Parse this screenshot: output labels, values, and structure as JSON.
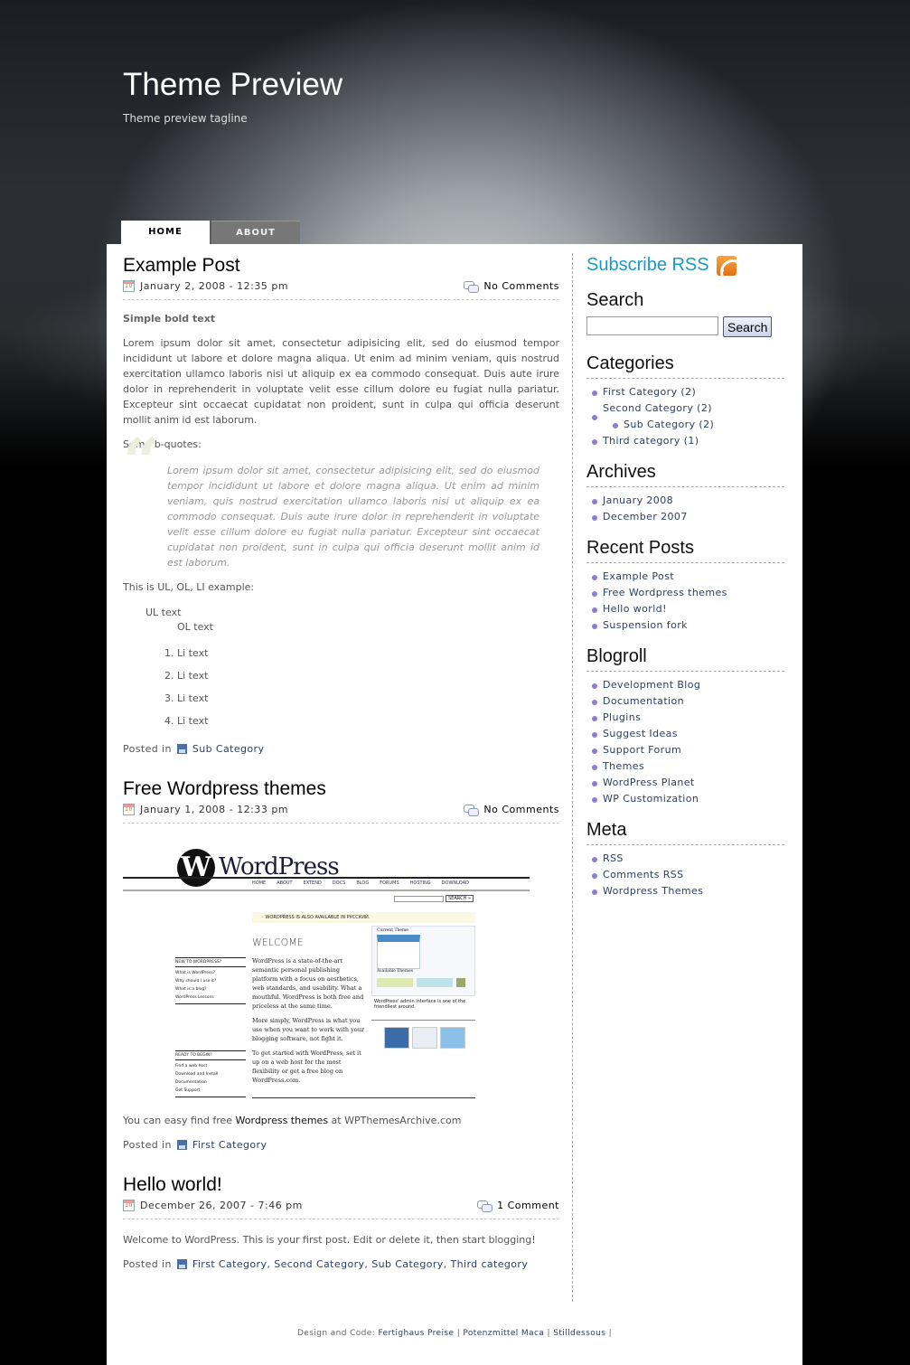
{
  "header": {
    "title": "Theme Preview",
    "tagline": "Theme preview tagline"
  },
  "nav": {
    "tabs": [
      {
        "label": "HOME",
        "active": true
      },
      {
        "label": "ABOUT",
        "active": false
      }
    ]
  },
  "posts": [
    {
      "title": "Example Post",
      "date": "January 2, 2008 - 12:35 pm",
      "comments": "No Comments",
      "bold": "Simple bold text",
      "para": "Lorem ipsum dolor sit amet, consectetur adipisicing elit, sed do eiusmod tempor incididunt ut labore et dolore magna aliqua. Ut enim ad minim veniam, quis nostrud exercitation ullamco laboris nisi ut aliquip ex ea commodo consequat. Duis aute irure dolor in reprehenderit in voluptate velit esse cillum dolore eu fugiat nulla pariatur. Excepteur sint occaecat cupidatat non proident, sunt in culpa qui officia deserunt mollit anim id est laborum.",
      "bquote_intro": "Some b-quotes:",
      "bquote": "Lorem ipsum dolor sit amet, consectetur adipisicing elit, sed do eiusmod tempor incididunt ut labore et dolore magna aliqua. Ut enim ad minim veniam, quis nostrud exercitation ullamco laboris nisi ut aliquip ex ea commodo consequat. Duis aute irure dolor in reprehenderit in voluptate velit esse cillum dolore eu fugiat nulla pariatur. Excepteur sint occaecat cupidatat non proident, sunt in culpa qui officia deserunt mollit anim id est laborum.",
      "list_intro": "This is UL, OL, LI example:",
      "ul_text": "UL text",
      "ol_text": "OL text",
      "li": [
        "Li text",
        "Li text",
        "Li text",
        "Li text"
      ],
      "posted_in": "Posted in",
      "categories": "Sub Category"
    },
    {
      "title": "Free Wordpress themes",
      "date": "January 1, 2008 - 12:33 pm",
      "comments": "No Comments",
      "text_before": "You can easy find free ",
      "link": "Wordpress themes",
      "text_after": " at WPThemesArchive.com",
      "posted_in": "Posted in",
      "categories": "First Category",
      "image": {
        "logo": "WordPress",
        "nav": [
          "HOME",
          "ABOUT",
          "EXTEND",
          "DOCS",
          "BLOG",
          "FORUMS",
          "HOSTING",
          "DOWNLOAD"
        ],
        "search": "SEARCH »",
        "notice": "◦ WORDPRESS IS ALSO AVAILABLE IN РУССКИЙ.",
        "welcome": "WELCOME",
        "new_heading": "NEW TO WORDPRESS?",
        "new_links": [
          "What is WordPress?",
          "Why should I use it?",
          "What is a blog?",
          "WordPress Lessons"
        ],
        "ready_heading": "READY TO BEGIN?",
        "ready_links": [
          "Find a web host",
          "Download and Install",
          "Documentation",
          "Get Support"
        ],
        "intro": "WordPress is a state-of-the-art semantic personal publishing platform with a focus on aesthetics, web standards, and usability. What a mouthful. WordPress is both free and priceless at the same time.",
        "p2": "More simply, WordPress is what you use when you want to work with your blogging software, not fight it.",
        "p3": "To get started with WordPress, set it up on a web host for the most flexibility or get a free blog on WordPress.com.",
        "current_theme": "Current Theme",
        "available_themes": "Available Themes",
        "caption": "WordPress' admin interface is one of the friendliest around."
      }
    },
    {
      "title": "Hello world!",
      "date": "December 26, 2007 - 7:46 pm",
      "comments": "1 Comment",
      "text": "Welcome to WordPress. This is your first post. Edit or delete it, then start blogging!",
      "posted_in": "Posted in",
      "categories": [
        "First Category",
        "Second Category",
        "Sub Category",
        "Third category"
      ]
    }
  ],
  "sidebar": {
    "rss": "Subscribe RSS",
    "search": {
      "title": "Search",
      "value": "",
      "button": "Search"
    },
    "categories": {
      "title": "Categories",
      "items": [
        "First Category (2)",
        "Second Category (2)",
        "Sub Category (2)",
        "Third category (1)"
      ]
    },
    "archives": {
      "title": "Archives",
      "items": [
        "January 2008",
        "December 2007"
      ]
    },
    "recent": {
      "title": "Recent Posts",
      "items": [
        "Example Post",
        "Free Wordpress themes",
        "Hello world!",
        "Suspension fork"
      ]
    },
    "blogroll": {
      "title": "Blogroll",
      "items": [
        "Development Blog",
        "Documentation",
        "Plugins",
        "Suggest Ideas",
        "Support Forum",
        "Themes",
        "WordPress Planet",
        "WP Customization"
      ]
    },
    "meta": {
      "title": "Meta",
      "items": [
        "RSS",
        "Comments RSS",
        "Wordpress Themes"
      ]
    }
  },
  "footer": {
    "prefix": "Design and Code:",
    "links": [
      "Fertighaus Preise",
      "Potenzmittel Maca",
      "Stilldessous"
    ],
    "sep": "|"
  },
  "colors": {
    "accent": "#1a9bc7",
    "link": "#2c3e63",
    "bullet": "#8a7fd0"
  }
}
